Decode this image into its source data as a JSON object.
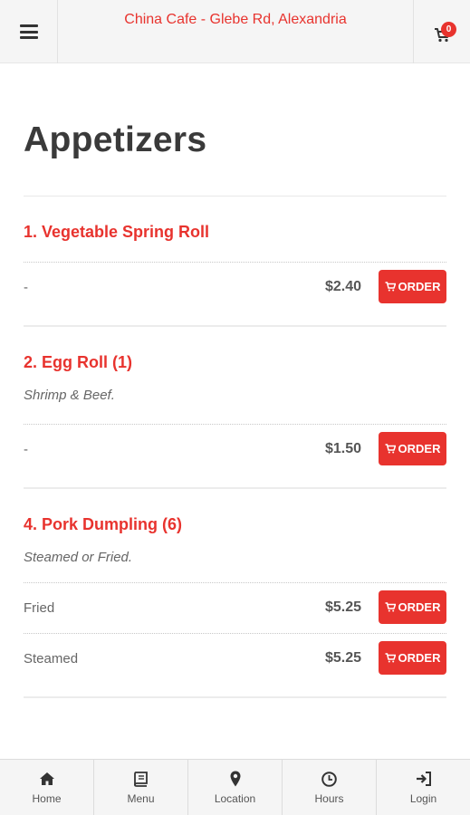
{
  "header": {
    "title": "China Cafe - Glebe Rd, Alexandria",
    "cart_count": "0",
    "menu_icon": "hamburger-icon",
    "cart_icon": "cart-icon"
  },
  "page": {
    "title": "Appetizers"
  },
  "items": [
    {
      "name": "1. Vegetable Spring Roll",
      "description": "",
      "variants": [
        {
          "label": "-",
          "price": "$2.40",
          "button": "ORDER"
        }
      ]
    },
    {
      "name": "2. Egg Roll (1)",
      "description": "Shrimp & Beef.",
      "variants": [
        {
          "label": "-",
          "price": "$1.50",
          "button": "ORDER"
        }
      ]
    },
    {
      "name": "4. Pork Dumpling (6)",
      "description": "Steamed or Fried.",
      "variants": [
        {
          "label": "Fried",
          "price": "$5.25",
          "button": "ORDER"
        },
        {
          "label": "Steamed",
          "price": "$5.25",
          "button": "ORDER"
        }
      ]
    }
  ],
  "bottom_nav": [
    {
      "label": "Home",
      "icon": "home-icon"
    },
    {
      "label": "Menu",
      "icon": "book-icon"
    },
    {
      "label": "Location",
      "icon": "map-marker-icon"
    },
    {
      "label": "Hours",
      "icon": "clock-icon"
    },
    {
      "label": "Login",
      "icon": "sign-in-icon"
    }
  ],
  "colors": {
    "accent": "#e8332e",
    "header_bg": "#f5f5f5",
    "title_text": "#3a3a3a"
  }
}
